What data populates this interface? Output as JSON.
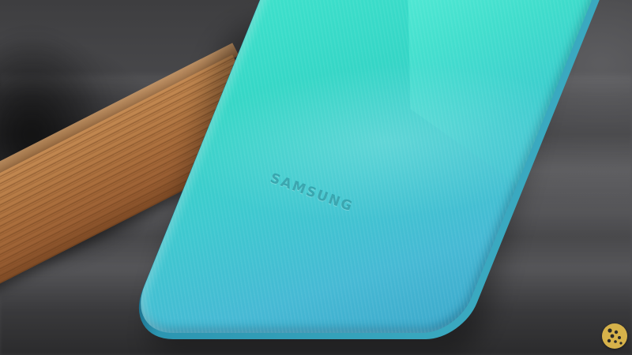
{
  "photo": {
    "subject": "smartphone-back-on-wooden-stick",
    "brand_text": "SAMSUNG",
    "colors": {
      "phone_primary": "#3ed6c8",
      "phone_edge": "#2c96b1",
      "wood": "#b57a45",
      "background": "#4a4a4c",
      "watermark": "#d6b24a"
    },
    "watermark_icon": "dots-logo-icon"
  }
}
